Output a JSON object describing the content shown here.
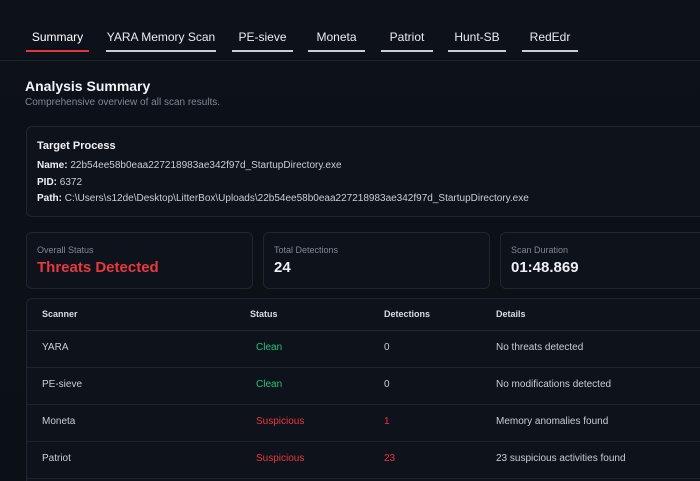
{
  "tabs": [
    {
      "label": "Summary",
      "active": true
    },
    {
      "label": "YARA Memory Scan",
      "active": false
    },
    {
      "label": "PE-sieve",
      "active": false
    },
    {
      "label": "Moneta",
      "active": false
    },
    {
      "label": "Patriot",
      "active": false
    },
    {
      "label": "Hunt-SB",
      "active": false
    },
    {
      "label": "RedEdr",
      "active": false
    }
  ],
  "summary": {
    "title": "Analysis Summary",
    "subtitle": "Comprehensive overview of all scan results."
  },
  "target": {
    "heading": "Target Process",
    "name_label": "Name:",
    "name_value": "22b54ee58b0eaa227218983ae342f97d_StartupDirectory.exe",
    "pid_label": "PID:",
    "pid_value": "6372",
    "path_label": "Path:",
    "path_value": "C:\\Users\\s12de\\Desktop\\LitterBox\\Uploads\\22b54ee58b0eaa227218983ae342f97d_StartupDirectory.exe"
  },
  "stats": {
    "overall_label": "Overall Status",
    "overall_value": "Threats Detected",
    "detections_label": "Total Detections",
    "detections_value": "24",
    "duration_label": "Scan Duration",
    "duration_value": "01:48.869"
  },
  "table": {
    "headers": {
      "scanner": "Scanner",
      "status": "Status",
      "detections": "Detections",
      "details": "Details"
    },
    "rows": [
      {
        "scanner": "YARA",
        "status": "Clean",
        "detections": "0",
        "details": "No threats detected"
      },
      {
        "scanner": "PE-sieve",
        "status": "Clean",
        "detections": "0",
        "details": "No modifications detected"
      },
      {
        "scanner": "Moneta",
        "status": "Suspicious",
        "detections": "1",
        "details": "Memory anomalies found"
      },
      {
        "scanner": "Patriot",
        "status": "Suspicious",
        "detections": "23",
        "details": "23 suspicious activities found"
      }
    ]
  },
  "colors": {
    "accent_red": "#e9383f",
    "clean_green": "#27c281",
    "background": "#0b0f17"
  }
}
